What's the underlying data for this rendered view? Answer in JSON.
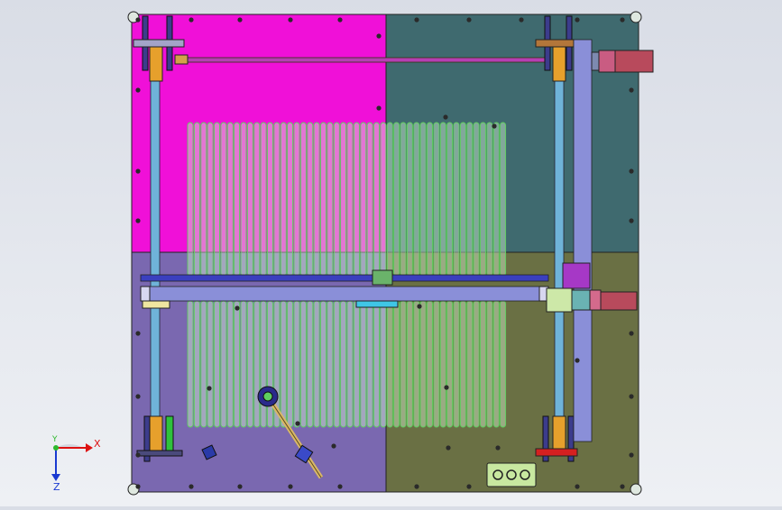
{
  "viewport": {
    "panel_colors": {
      "top_left": "#f010d8",
      "top_right": "#3f6a6f",
      "bottom_left": "#7a68b0",
      "bottom_right": "#6a7044",
      "tube_fill": "#d4f5d0",
      "tube_stroke": "#5fcf5f",
      "rail": "#6fb3d9",
      "beam": "#8a8fd8"
    },
    "triad": {
      "x_label": "X",
      "y_label": "Y",
      "z_label": "Z"
    }
  }
}
